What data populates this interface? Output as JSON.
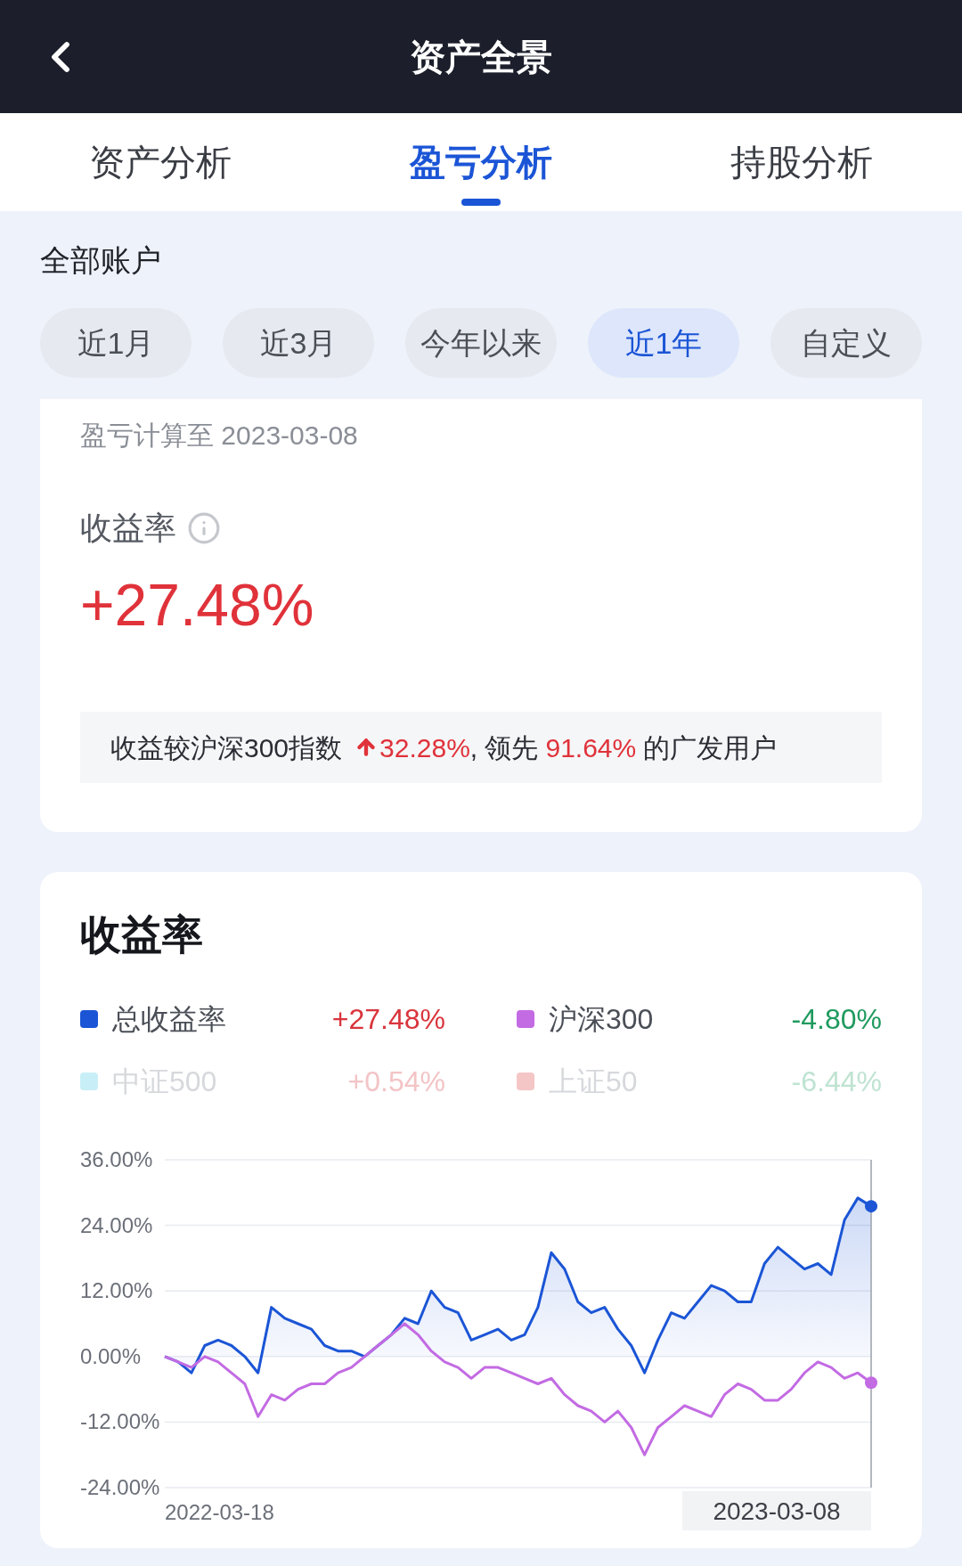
{
  "header": {
    "title": "资产全景"
  },
  "tabs": [
    {
      "label": "资产分析",
      "selected": false
    },
    {
      "label": "盈亏分析",
      "selected": true
    },
    {
      "label": "持股分析",
      "selected": false
    }
  ],
  "account": "全部账户",
  "periods": [
    {
      "label": "近1月",
      "selected": false
    },
    {
      "label": "近3月",
      "selected": false
    },
    {
      "label": "今年以来",
      "selected": false
    },
    {
      "label": "近1年",
      "selected": true
    },
    {
      "label": "自定义",
      "selected": false
    }
  ],
  "summary": {
    "as_of": "盈亏计算至 2023-03-08",
    "label": "收益率",
    "value": "+27.48%",
    "compare_prefix": "收益较沪深300指数",
    "compare_value": "32.28%",
    "compare_middle": ", 领先",
    "compare_rank": "91.64%",
    "compare_suffix": "的广发用户"
  },
  "chart_card": {
    "title": "收益率",
    "legend": [
      {
        "label": "总收益率",
        "value": "+27.48%",
        "color": "#1b55d6",
        "active": true,
        "gain": true
      },
      {
        "label": "沪深300",
        "value": "-4.80%",
        "color": "#c36be3",
        "active": true,
        "gain": false
      },
      {
        "label": "中证500",
        "value": "+0.54%",
        "color": "#c8eff7",
        "active": false,
        "gain": true
      },
      {
        "label": "上证50",
        "value": "-6.44%",
        "color": "#f5c6c6",
        "active": false,
        "gain": false
      }
    ],
    "start_date": "2022-03-18",
    "end_date": "2023-03-08",
    "chart_data": {
      "type": "line",
      "grid": true,
      "ylim": [
        -24,
        36
      ],
      "yticks": [
        {
          "value": 36,
          "label": "36.00%"
        },
        {
          "value": 24,
          "label": "24.00%"
        },
        {
          "value": 12,
          "label": "12.00%"
        },
        {
          "value": 0,
          "label": "0.00%"
        },
        {
          "value": -12,
          "label": "-12.00%"
        },
        {
          "value": -24,
          "label": "-24.00%"
        }
      ],
      "series": [
        {
          "type": "area",
          "color": "#1b55d6",
          "values": [
            0,
            -1,
            -3,
            2,
            3,
            2,
            0,
            -3,
            9,
            7,
            6,
            5,
            2,
            1,
            1,
            0,
            2,
            4,
            7,
            6,
            12,
            9,
            8,
            3,
            4,
            5,
            3,
            4,
            9,
            19,
            16,
            10,
            8,
            9,
            5,
            2,
            -3,
            3,
            8,
            7,
            10,
            13,
            12,
            10,
            10,
            17,
            20,
            18,
            16,
            17,
            15,
            25,
            29,
            27.5
          ]
        },
        {
          "type": "line",
          "color": "#c36be3",
          "values": [
            0,
            -1,
            -2,
            0,
            -1,
            -3,
            -5,
            -11,
            -7,
            -8,
            -6,
            -5,
            -5,
            -3,
            -2,
            0,
            2,
            4,
            6,
            4,
            1,
            -1,
            -2,
            -4,
            -2,
            -2,
            -3,
            -4,
            -5,
            -4,
            -7,
            -9,
            -10,
            -12,
            -10,
            -13,
            -18,
            -13,
            -11,
            -9,
            -10,
            -11,
            -7,
            -5,
            -6,
            -8,
            -8,
            -6,
            -3,
            -1,
            -2,
            -4,
            -3,
            -4.8
          ]
        }
      ]
    }
  }
}
